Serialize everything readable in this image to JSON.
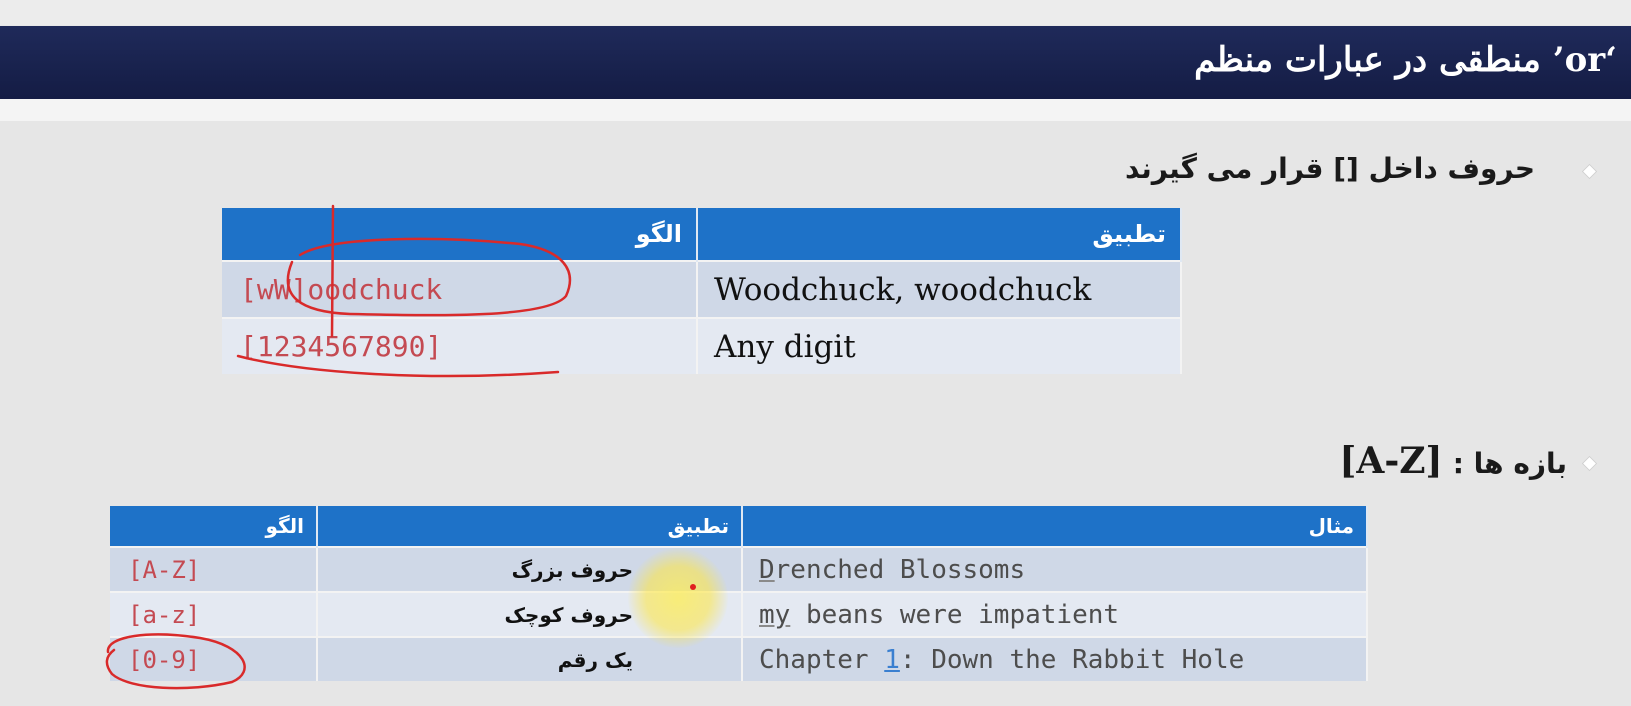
{
  "slide": {
    "title": "‘or’ منطقی در عبارات منظم"
  },
  "section1": {
    "heading": "حروف داخل [] قرار می گیرند",
    "table": {
      "headers": {
        "pattern": "الگو",
        "match": "تطبیق"
      },
      "rows": [
        {
          "pattern": "[wW]oodchuck",
          "match": "Woodchuck, woodchuck"
        },
        {
          "pattern": "[1234567890]",
          "match": "Any digit"
        }
      ]
    }
  },
  "section2": {
    "heading_prefix": "بازه ها :",
    "heading_range": "[A-Z]",
    "table": {
      "headers": {
        "pattern": "الگو",
        "meaning": "تطبیق",
        "example": "مثال"
      },
      "rows": [
        {
          "pattern": "[A-Z]",
          "meaning": "حروف بزرگ",
          "example_head": "D",
          "example_tail": "renched Blossoms"
        },
        {
          "pattern": "[a-z]",
          "meaning": "حروف کوچک",
          "example_head": "my",
          "example_tail": " beans were impatient"
        },
        {
          "pattern": "[0-9]",
          "meaning": "یک رقم",
          "example_pre": "Chapter ",
          "example_digit": "1",
          "example_post": ": Down the Rabbit Hole"
        }
      ]
    }
  },
  "colors": {
    "title_bar": "#1f2a5a",
    "table_header": "#1e72c8",
    "pattern_text": "#c44a52",
    "annotation_ink": "#d92a2a",
    "cursor_highlight": "#ffe850"
  }
}
